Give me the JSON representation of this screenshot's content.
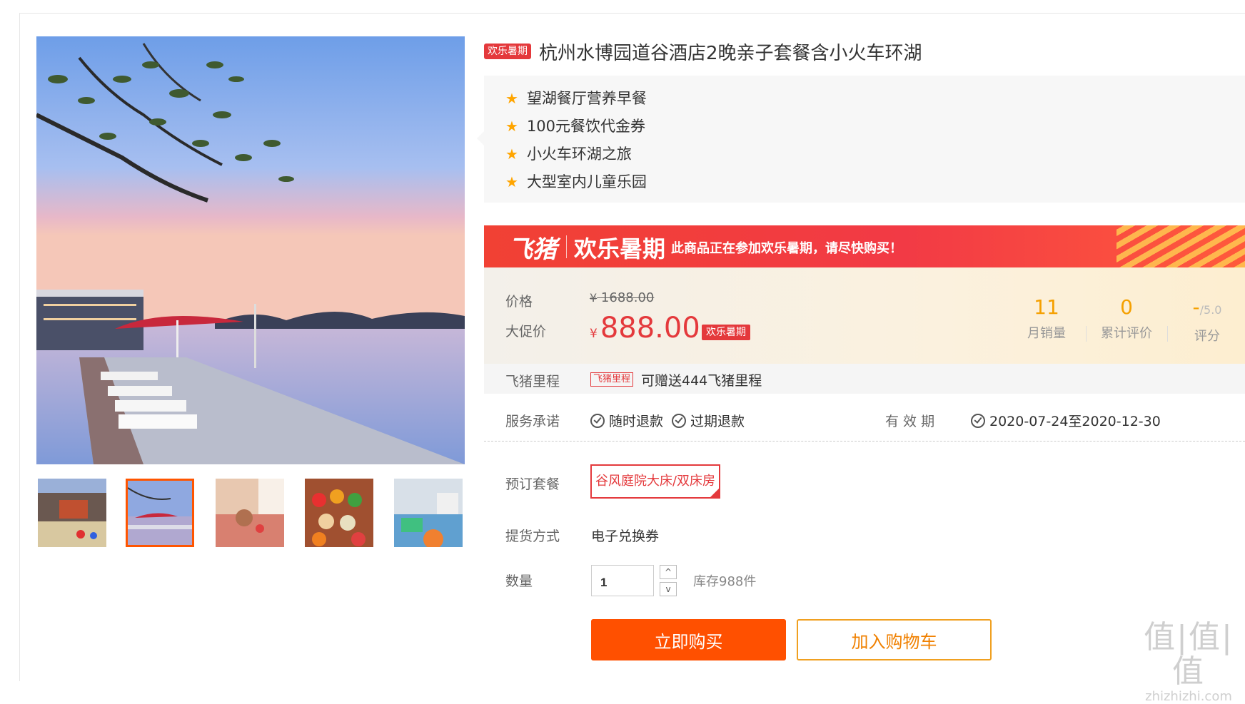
{
  "product": {
    "badge": "欢乐暑期",
    "title": "杭州水博园道谷酒店2晚亲子套餐含小火车环湖"
  },
  "highlights": [
    "望湖餐厅营养早餐",
    "100元餐饮代金券",
    "小火车环湖之旅",
    "大型室内儿童乐园"
  ],
  "promo": {
    "brand": "飞猪",
    "title": "欢乐暑期",
    "text": "此商品正在参加欢乐暑期，请尽快购买！"
  },
  "price": {
    "label": "价格",
    "currency": "¥",
    "original": "1688.00",
    "promo_label": "大促价",
    "promo_value": "888.00",
    "promo_badge": "欢乐暑期"
  },
  "stats": [
    {
      "value": "11",
      "label": "月销量"
    },
    {
      "value": "0",
      "label": "累计评价"
    },
    {
      "value": "-",
      "suffix": "/5.0",
      "label": "评分"
    }
  ],
  "mileage": {
    "label": "飞猪里程",
    "tag": "飞猪里程",
    "text": "可赠送444飞猪里程"
  },
  "service": {
    "label": "服务承诺",
    "items": [
      "随时退款",
      "过期退款"
    ],
    "validity_label": "有 效 期",
    "validity": "2020-07-24至2020-12-30"
  },
  "package": {
    "label": "预订套餐",
    "selected": "谷风庭院大床/双床房"
  },
  "delivery": {
    "label": "提货方式",
    "value": "电子兑换券"
  },
  "quantity": {
    "label": "数量",
    "value": "1",
    "up": "^",
    "down": "v",
    "stock": "库存988件"
  },
  "actions": {
    "buy": "立即购买",
    "cart": "加入购物车"
  },
  "watermark": {
    "big": "值|值|值",
    "small": "zhizhizhi.com"
  },
  "colors": {
    "brand_red": "#e4393c",
    "buy_orange": "#ff5000",
    "stat_gold": "#f5a000"
  }
}
